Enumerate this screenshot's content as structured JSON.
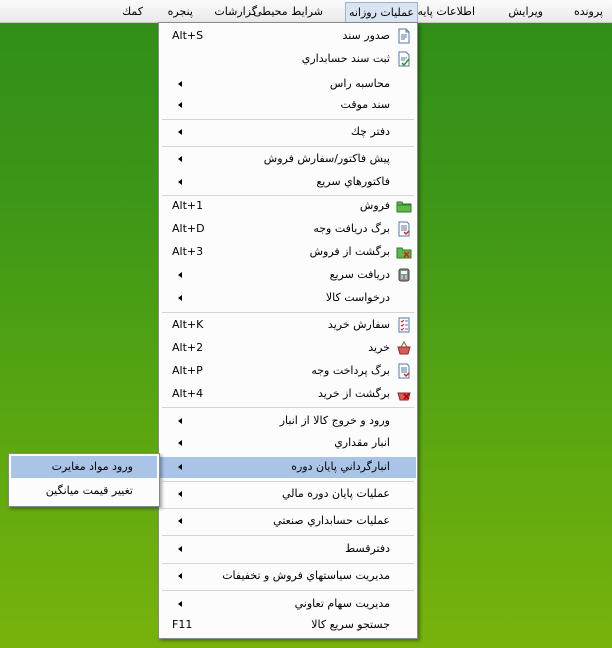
{
  "menubar": {
    "items": [
      {
        "label": "پرونده"
      },
      {
        "label": "ویرایش"
      },
      {
        "label": "اطلاعات پایه"
      },
      {
        "label": "عملیات روزانه"
      },
      {
        "label": "شرایط محیطی"
      },
      {
        "label": "گزارشات"
      },
      {
        "label": "پنجره"
      },
      {
        "label": "كمك"
      }
    ],
    "active_index": 3
  },
  "dropdown": {
    "items": [
      {
        "label": "صدور سند",
        "shortcut": "Alt+S",
        "icon": "document-icon"
      },
      {
        "label": "ثبت سند حسابداري",
        "icon": "document-check-icon"
      },
      {
        "label": "محاسبه راس",
        "submenu": true
      },
      {
        "label": "سند موقت",
        "submenu": true
      },
      {
        "label": "دفتر چك",
        "submenu": true
      },
      {
        "label": "پیش فاكتور/سفارش فروش",
        "submenu": true
      },
      {
        "label": "فاكتورهاي سريع",
        "submenu": true
      },
      {
        "label": "فروش",
        "shortcut": "Alt+1",
        "icon": "folder-green-icon"
      },
      {
        "label": "برگ دريافت وجه",
        "shortcut": "Alt+D",
        "icon": "receipt-icon"
      },
      {
        "label": "برگشت از فروش",
        "shortcut": "Alt+3",
        "icon": "folder-return-icon"
      },
      {
        "label": "دريافت سريع",
        "submenu": true,
        "icon": "cash-register-icon"
      },
      {
        "label": "درخواست كالا",
        "submenu": true
      },
      {
        "label": "سفارش خريد",
        "shortcut": "Alt+K",
        "icon": "checklist-icon"
      },
      {
        "label": "خريد",
        "shortcut": "Alt+2",
        "icon": "basket-icon"
      },
      {
        "label": "برگ پرداخت وجه",
        "shortcut": "Alt+P",
        "icon": "payment-doc-icon"
      },
      {
        "label": "برگشت از خريد",
        "shortcut": "Alt+4",
        "icon": "basket-return-icon"
      },
      {
        "label": "ورود و خروج كالا از انبار",
        "submenu": true
      },
      {
        "label": "انبار مقداري",
        "submenu": true
      },
      {
        "label": "انبارگرداني پايان دوره",
        "submenu": true
      },
      {
        "label": "عمليات پايان دوره مالي",
        "submenu": true
      },
      {
        "label": "عمليات حسابداري صنعتي",
        "submenu": true
      },
      {
        "label": "دفترقسط",
        "submenu": true
      },
      {
        "label": "مديريت سياستهاي فروش و تخفيفات",
        "submenu": true
      },
      {
        "label": "مديريت سهام تعاوني",
        "submenu": true
      },
      {
        "label": "جستجو سريع كالا",
        "shortcut": "F11"
      }
    ],
    "highlighted_index": 18
  },
  "submenu": {
    "items": [
      {
        "label": "ورود مواد مغايرت"
      },
      {
        "label": "تغيير قيمت ميانگين"
      }
    ],
    "highlighted_index": 0
  },
  "colors": {
    "highlight": "#a9c4e6",
    "desktop_top": "#2f8d18",
    "desktop_bottom": "#78b30c"
  }
}
